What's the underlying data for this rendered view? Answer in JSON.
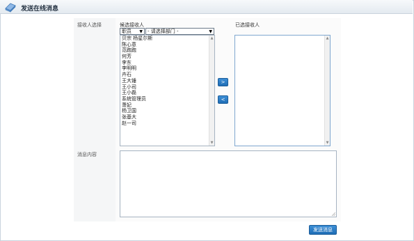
{
  "window": {
    "title": "发送在线消息"
  },
  "form": {
    "recipient_label": "接收人选择",
    "candidates_label": "候选接收人",
    "selected_label": "已选接收人",
    "type_select_value": "职员",
    "dept_select_value": "- 请选择部门 -",
    "candidates": [
      "贝宗 杨星尔斯",
      "陈心意",
      "范跑跑",
      "何芳",
      "李东",
      "李明明",
      "卉石",
      "王大锤",
      "王小司",
      "王小磊",
      "系统管理员",
      "萧妃",
      "杨卫国",
      "张基大",
      "赵一司"
    ],
    "selected": [],
    "add_button": ">",
    "remove_button": "<",
    "message_label": "消息内容",
    "message_value": "",
    "send_button": "发送消息"
  },
  "colors": {
    "button_blue": "#1f6db5",
    "panel_bg": "#f5f6f7",
    "title_text": "#1f2d3d"
  },
  "icons": {
    "title": "message-icon",
    "dropdown": "triangle-down",
    "scroll_up": "triangle-up",
    "scroll_down": "triangle-down",
    "resize": "resize-grip"
  }
}
